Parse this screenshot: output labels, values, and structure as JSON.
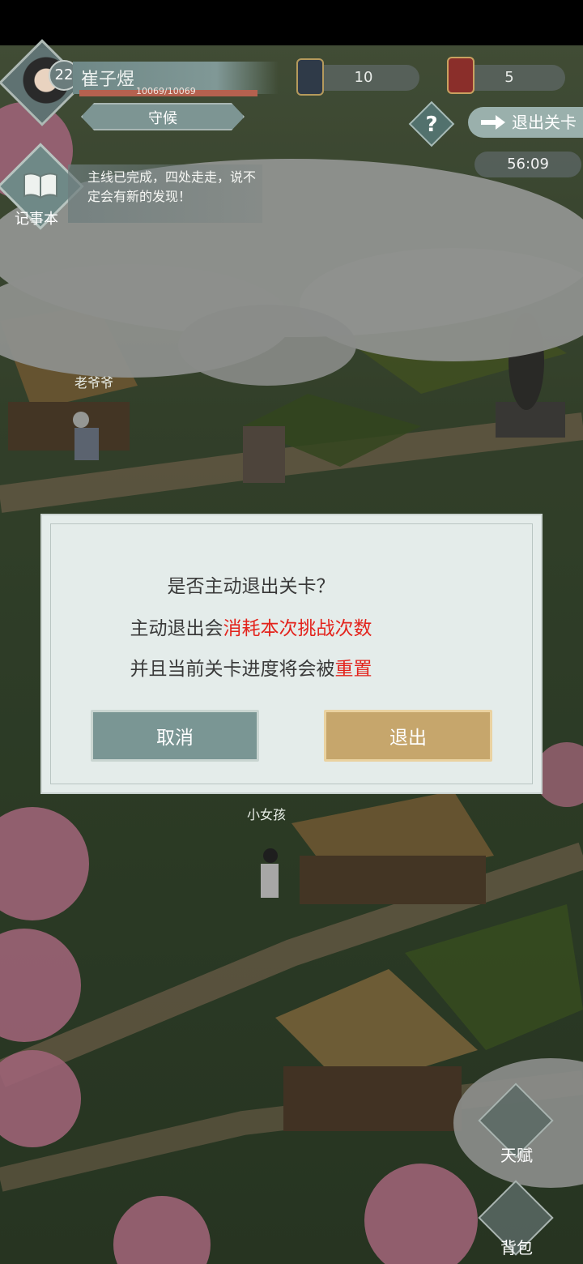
{
  "player": {
    "name": "崔子煜",
    "level": "22",
    "hp": "10069/10069",
    "state": "守候"
  },
  "resources": [
    {
      "icon": "token-icon",
      "value": "10"
    },
    {
      "icon": "ticket-icon",
      "value": "5"
    }
  ],
  "header": {
    "help": "?",
    "exit_label": "退出关卡",
    "timer": "56:09"
  },
  "journal": {
    "label": "记事本",
    "quest_text": "主线已完成，四处走走，说不定会有新的发现！"
  },
  "npcs": {
    "grandpa": "老爷爷",
    "girl": "小女孩"
  },
  "dialog": {
    "line1": "是否主动退出关卡？",
    "line2_prefix": "主动退出会",
    "line2_red": "消耗本次挑战次数",
    "line3_prefix": "并且当前关卡进度将会被",
    "line3_red": "重置",
    "cancel": "取消",
    "confirm": "退出"
  },
  "side": {
    "talent": "天赋",
    "bag": "背包"
  },
  "colors": {
    "red_text": "#e3231c",
    "cancel_btn": "#7a9694",
    "exit_btn": "#c6a66c"
  }
}
